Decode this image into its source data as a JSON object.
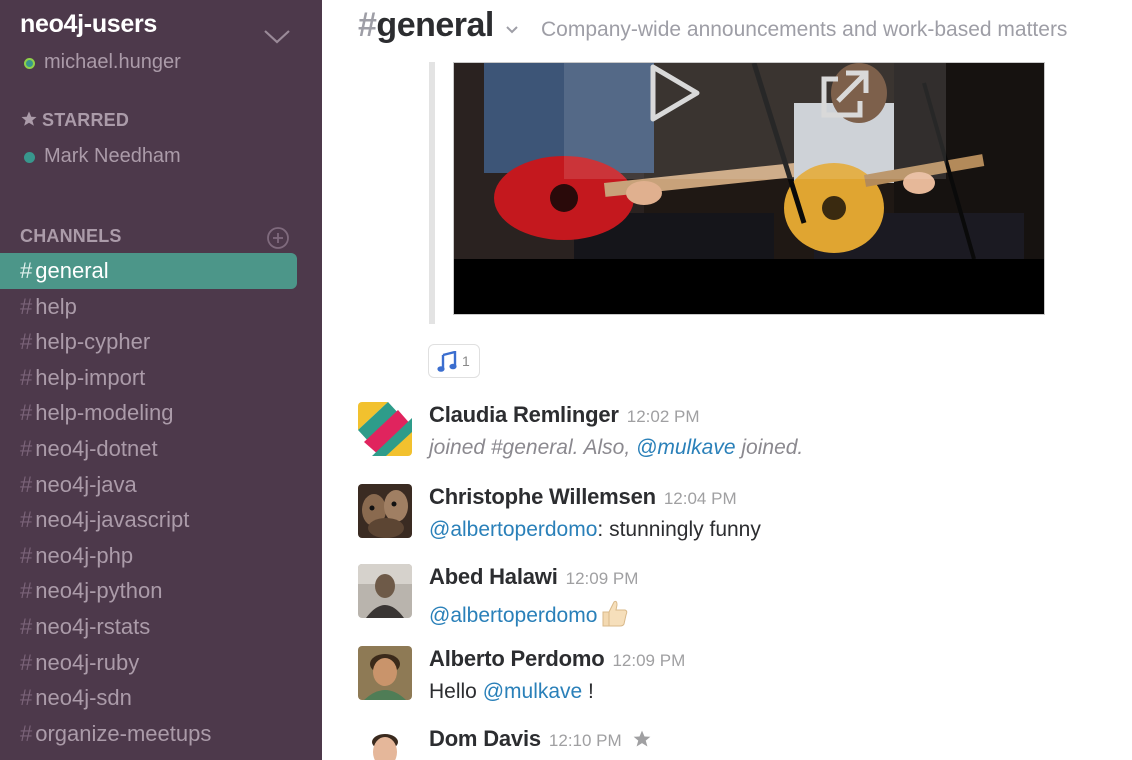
{
  "sidebar": {
    "team_name": "neo4j-users",
    "current_user": "michael.hunger",
    "starred_title": "STARRED",
    "starred_items": [
      {
        "name": "Mark Needham"
      }
    ],
    "channels_title": "CHANNELS",
    "channels": [
      {
        "name": "general",
        "active": true
      },
      {
        "name": "help"
      },
      {
        "name": "help-cypher"
      },
      {
        "name": "help-import"
      },
      {
        "name": "help-modeling"
      },
      {
        "name": "neo4j-dotnet"
      },
      {
        "name": "neo4j-java"
      },
      {
        "name": "neo4j-javascript"
      },
      {
        "name": "neo4j-php"
      },
      {
        "name": "neo4j-python"
      },
      {
        "name": "neo4j-rstats"
      },
      {
        "name": "neo4j-ruby"
      },
      {
        "name": "neo4j-sdn"
      },
      {
        "name": "organize-meetups"
      }
    ],
    "hash": "#"
  },
  "header": {
    "hash": "#",
    "channel_name": "general",
    "topic": "Company-wide announcements and work-based matters"
  },
  "reaction": {
    "emoji": "musical-notes-icon",
    "count": "1"
  },
  "messages": [
    {
      "sender": "Claudia Remlinger",
      "time": "12:02 PM",
      "body_pre": "joined #general. Also, ",
      "mention": "@mulkave",
      "body_post": " joined."
    },
    {
      "sender": "Christophe Willemsen",
      "time": "12:04 PM",
      "mention": "@albertoperdomo",
      "body_post": ": stunningly funny"
    },
    {
      "sender": "Abed Halawi",
      "time": "12:09 PM",
      "mention": "@albertoperdomo",
      "emoji": "thumbs-up-icon"
    },
    {
      "sender": "Alberto Perdomo",
      "time": "12:09 PM",
      "body_pre": "Hello ",
      "mention": "@mulkave",
      "body_post": " !"
    },
    {
      "sender": "Dom Davis",
      "time": "12:10 PM"
    }
  ],
  "colors": {
    "sidebar_bg": "#4d394b",
    "active_channel": "#4c9689",
    "mention": "#2a80b9",
    "presence": "#38978d"
  }
}
